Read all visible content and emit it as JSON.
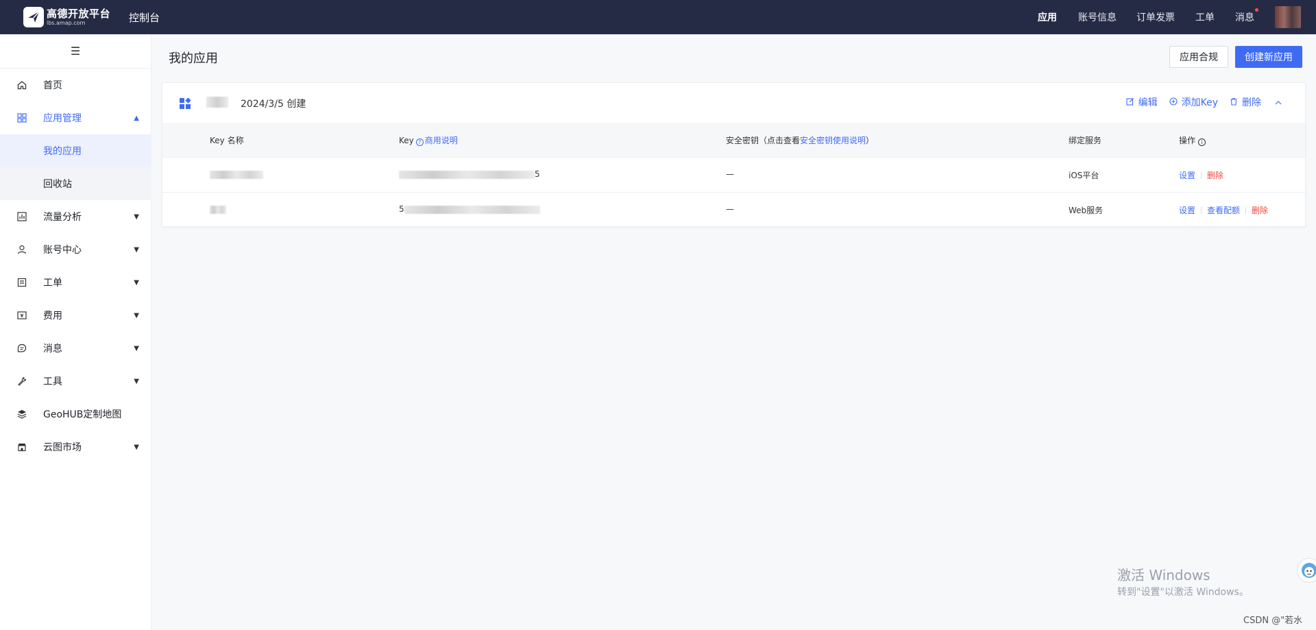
{
  "topbar": {
    "logo_title": "高德开放平台",
    "logo_subtitle": "lbs.amap.com",
    "console": "控制台",
    "nav": [
      "应用",
      "账号信息",
      "订单发票",
      "工单",
      "消息"
    ],
    "active_nav": "应用"
  },
  "sidebar": {
    "items": [
      {
        "label": "首页",
        "icon": "home-icon"
      },
      {
        "label": "应用管理",
        "icon": "grid-icon",
        "expanded": true
      },
      {
        "label": "我的应用",
        "sub": true,
        "active": true
      },
      {
        "label": "回收站",
        "sub": true
      },
      {
        "label": "流量分析",
        "icon": "chart-icon"
      },
      {
        "label": "账号中心",
        "icon": "user-icon"
      },
      {
        "label": "工单",
        "icon": "ticket-icon"
      },
      {
        "label": "费用",
        "icon": "fee-icon"
      },
      {
        "label": "消息",
        "icon": "message-icon"
      },
      {
        "label": "工具",
        "icon": "wrench-icon"
      },
      {
        "label": "GeoHUB定制地图",
        "icon": "layers-icon"
      },
      {
        "label": "云图市场",
        "icon": "store-icon"
      }
    ]
  },
  "main": {
    "title": "我的应用",
    "btn_compliance": "应用合规",
    "btn_create": "创建新应用"
  },
  "app_card": {
    "created": "2024/3/5 创建",
    "actions": {
      "edit": "编辑",
      "add_key": "添加Key",
      "delete": "删除"
    },
    "table": {
      "headers": {
        "key_name": "Key 名称",
        "key": "Key",
        "key_link": "商用说明",
        "secret_prefix": "安全密钥（点击查看",
        "secret_link": "安全密钥使用说明",
        "secret_suffix": "）",
        "service": "绑定服务",
        "ops": "操作"
      },
      "rows": [
        {
          "secret": "—",
          "service": "iOS平台",
          "key_tail": "5",
          "ops": [
            "设置",
            "删除"
          ]
        },
        {
          "secret": "—",
          "service": "Web服务",
          "key_head": "5",
          "ops": [
            "设置",
            "查看配额",
            "删除"
          ]
        }
      ]
    }
  },
  "watermark": {
    "title": "激活 Windows",
    "subtitle": "转到\"设置\"以激活 Windows。"
  },
  "credit": "CSDN @\"若水"
}
